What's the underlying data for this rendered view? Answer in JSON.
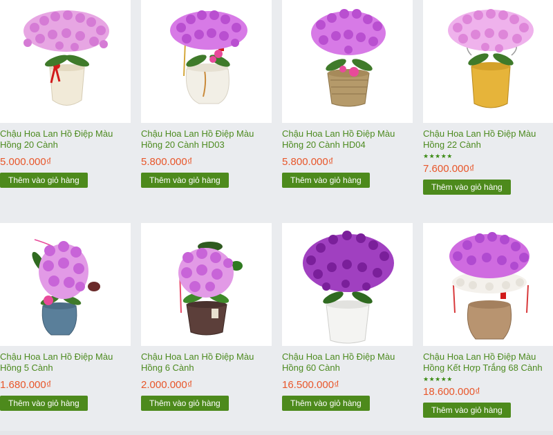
{
  "colors": {
    "title": "#4c8a1f",
    "price": "#e8562a",
    "button": "#4d8a1c",
    "stars": "#3a8a12"
  },
  "products": [
    {
      "title": "Chậu Hoa Lan Hồ Điệp Màu Hồng 20 Cành",
      "price": "5.000.000₫",
      "button": "Thêm vào giỏ hàng",
      "stars": "",
      "image": "orchid-pink-cream-pot-icon"
    },
    {
      "title": "Chậu Hoa Lan Hồ Điệp Màu Hồng 20 Cành HD03",
      "price": "5.800.000₫",
      "button": "Thêm vào giỏ hàng",
      "stars": "",
      "image": "orchid-pink-white-pot-icon"
    },
    {
      "title": "Chậu Hoa Lan Hồ Điệp Màu Hồng 20 Cành HD04",
      "price": "5.800.000₫",
      "button": "Thêm vào giỏ hàng",
      "stars": "",
      "image": "orchid-pink-basket-pot-icon"
    },
    {
      "title": "Chậu Hoa Lan Hồ Điệp Màu Hồng 22 Cành",
      "price": "7.600.000₫",
      "button": "Thêm vào giỏ hàng",
      "stars": "★★★★★",
      "image": "orchid-pink-yellow-pot-icon"
    },
    {
      "title": "Chậu Hoa Lan Hồ Điệp Màu Hồng 5 Cành",
      "price": "1.680.000₫",
      "button": "Thêm vào giỏ hàng",
      "stars": "",
      "image": "orchid-pink-blue-pot-icon"
    },
    {
      "title": "Chậu Hoa Lan Hồ Điệp Màu Hồng 6 Cành",
      "price": "2.000.000₫",
      "button": "Thêm vào giỏ hàng",
      "stars": "",
      "image": "orchid-pink-dark-pot-icon"
    },
    {
      "title": "Chậu Hoa Lan Hồ Điệp Màu Hồng 60 Cành",
      "price": "16.500.000₫",
      "button": "Thêm vào giỏ hàng",
      "stars": "",
      "image": "orchid-purple-white-pot-icon"
    },
    {
      "title": "Chậu Hoa Lan Hồ Điệp Màu Hồng Kết Hợp Trắng 68 Cành",
      "price": "18.600.000₫",
      "button": "Thêm vào giỏ hàng",
      "stars": "★★★★★",
      "image": "orchid-pink-white-mix-pot-icon"
    }
  ]
}
